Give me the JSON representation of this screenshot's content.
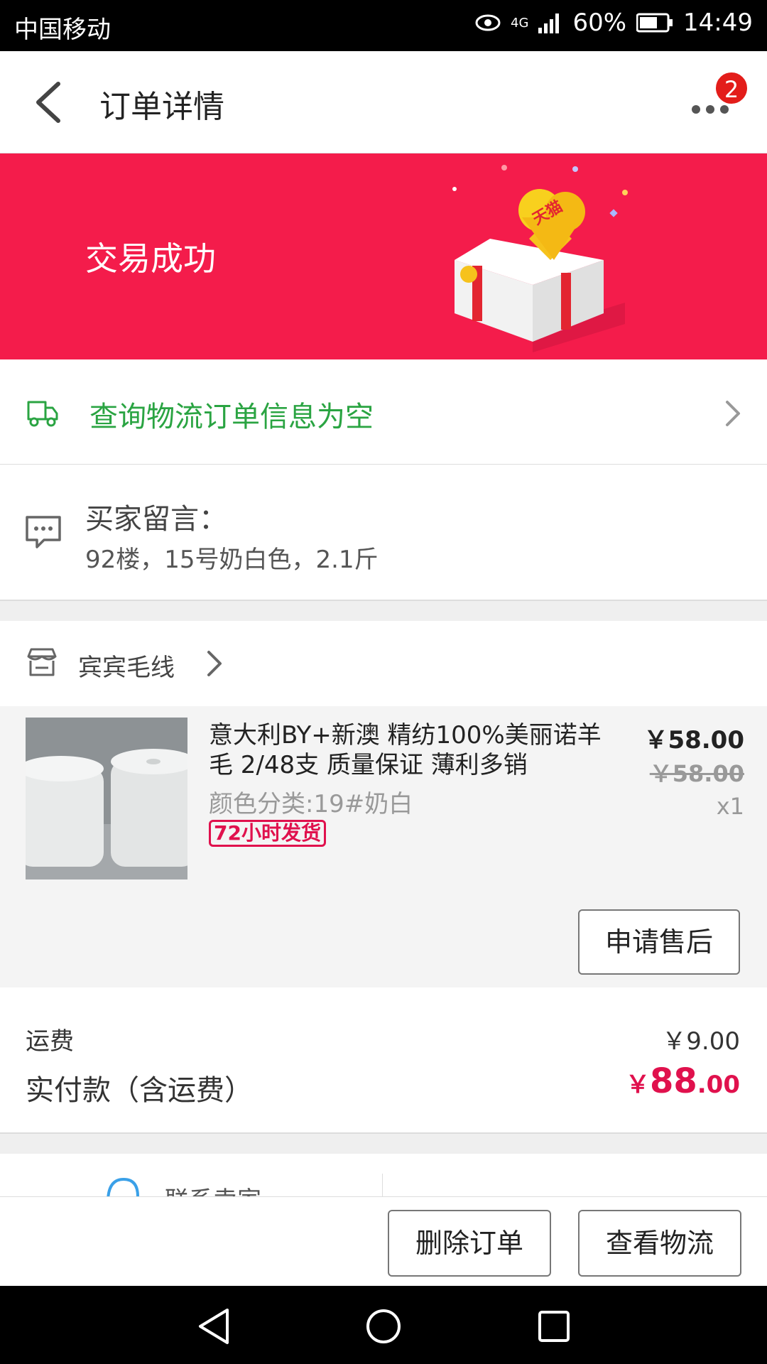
{
  "status_bar": {
    "carrier": "中国移动",
    "network": "4G",
    "battery": "60%",
    "time": "14:49"
  },
  "header": {
    "title": "订单详情",
    "badge_count": "2",
    "icons": [
      "back-arrow-icon",
      "more-icon"
    ]
  },
  "banner": {
    "status": "交易成功",
    "bg_color": "#f41c4b",
    "gift_label": "天猫"
  },
  "logistics": {
    "text": "查询物流订单信息为空",
    "color": "#2aa442"
  },
  "message": {
    "label": "买家留言：",
    "content": "92楼，15号奶白色，2.1斤"
  },
  "shop": {
    "name": "宾宾毛线"
  },
  "product": {
    "title": "意大利BY+新澳  精纺100%美丽诺羊毛 2/48支 质量保证 薄利多销",
    "variant": "颜色分类:19#奶白",
    "tag": "72小时发货",
    "price": "￥58.00",
    "original_price": "￥58.00",
    "quantity": "x1",
    "after_sale_label": "申请售后"
  },
  "fees": {
    "shipping_label": "运费",
    "shipping_value": "￥9.00",
    "paid_label": "实付款（含运费）",
    "paid_currency": "￥",
    "paid_integer": "88",
    "paid_decimal": ".00",
    "accent_color": "#e0114d"
  },
  "contact": {
    "text": "联系卖家"
  },
  "actions": {
    "delete_label": "删除订单",
    "logistics_label": "查看物流"
  }
}
